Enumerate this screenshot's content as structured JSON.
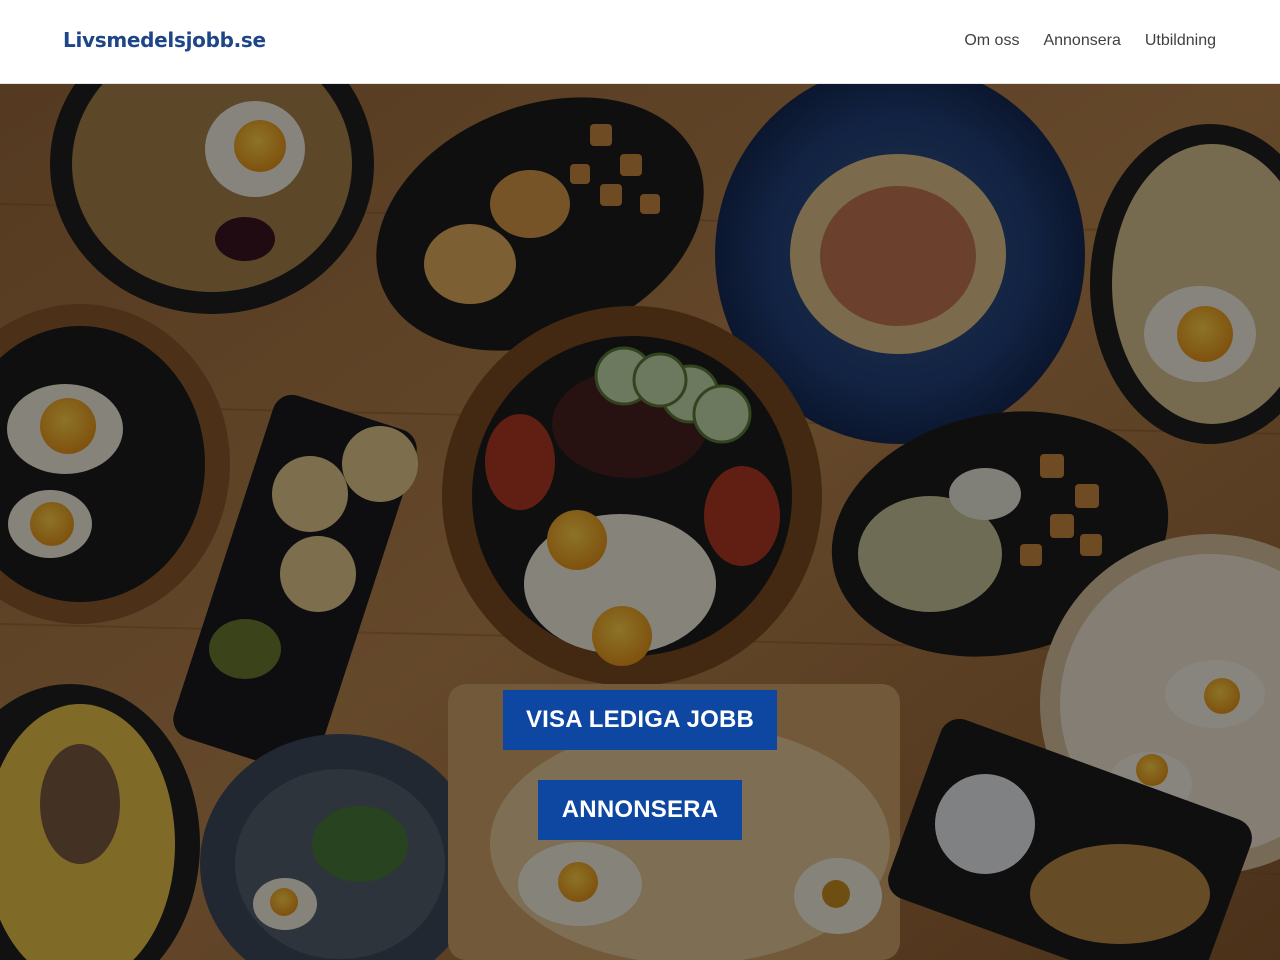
{
  "header": {
    "logo_text": "Livsmedelsjobb.se",
    "nav": [
      {
        "label": "Om oss"
      },
      {
        "label": "Annonsera"
      },
      {
        "label": "Utbildning"
      }
    ]
  },
  "hero": {
    "image": "food-table-photo",
    "buttons": [
      {
        "label": "VISA LEDIGA JOBB"
      },
      {
        "label": "ANNONSERA"
      }
    ]
  },
  "colors": {
    "brand": "#1d4587",
    "button": "#0d47a1",
    "nav_text": "#404040"
  }
}
